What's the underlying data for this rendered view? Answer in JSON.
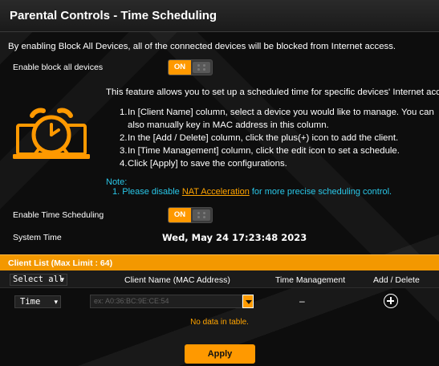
{
  "header": {
    "title": "Parental Controls - Time Scheduling"
  },
  "intro": {
    "text": "By enabling Block All Devices, all of the connected devices will be blocked from Internet access."
  },
  "block_all": {
    "label": "Enable block all devices",
    "toggle_text": "ON"
  },
  "info": {
    "intro": "This feature allows you to set up a scheduled time for specific devices' Internet access.",
    "steps": [
      {
        "num": "1.",
        "text": "In [Client Name] column, select a device you would like to manage. You can also manually key in MAC address in this column."
      },
      {
        "num": "2.",
        "text": "In the [Add / Delete] column, click the plus(+) icon to add the client."
      },
      {
        "num": "3.",
        "text": "In [Time Management] column, click the edit icon to set a schedule."
      },
      {
        "num": "4.",
        "text": "Click [Apply] to save the configurations."
      }
    ],
    "note_label": "Note:",
    "note_prefix": "1. Please disable ",
    "note_link": "NAT Acceleration",
    "note_suffix": " for more precise scheduling control."
  },
  "time_scheduling": {
    "label": "Enable Time Scheduling",
    "toggle_text": "ON"
  },
  "system_time": {
    "label": "System Time",
    "value": "Wed, May 24 17:23:48 2023"
  },
  "client_list": {
    "header": "Client List (Max Limit : 64)",
    "select_all": "Select all",
    "columns": {
      "client_name": "Client Name (MAC Address)",
      "time_management": "Time Management",
      "add_delete": "Add / Delete"
    },
    "row": {
      "mode": "Time",
      "mac_placeholder": "ex: A0:36:BC:9E:CE:54",
      "time_management": "–"
    },
    "empty_text": "No data in table."
  },
  "actions": {
    "apply": "Apply"
  },
  "colors": {
    "accent": "#FF9900",
    "note": "#29C7E8",
    "bg": "#0D0D0D"
  },
  "icons": {
    "plus": "plus-circle-icon",
    "dropdown": "chevron-down-icon",
    "illustration": "alarm-clock-laptop-icon"
  }
}
